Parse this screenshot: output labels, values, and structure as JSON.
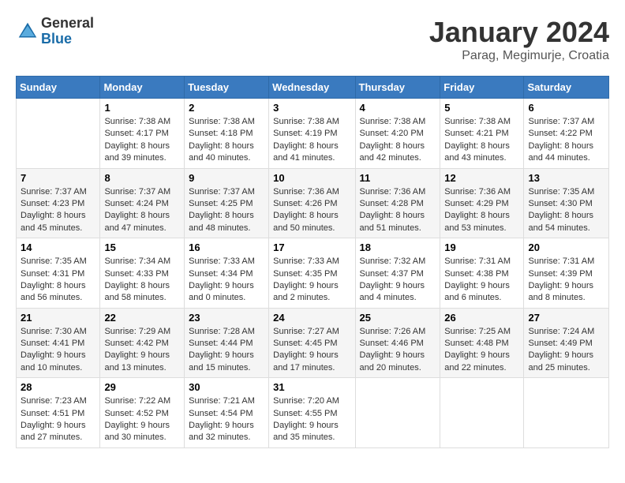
{
  "header": {
    "logo_general": "General",
    "logo_blue": "Blue",
    "month_title": "January 2024",
    "location": "Parag, Megimurje, Croatia"
  },
  "weekdays": [
    "Sunday",
    "Monday",
    "Tuesday",
    "Wednesday",
    "Thursday",
    "Friday",
    "Saturday"
  ],
  "weeks": [
    [
      {
        "day": "",
        "info": ""
      },
      {
        "day": "1",
        "info": "Sunrise: 7:38 AM\nSunset: 4:17 PM\nDaylight: 8 hours\nand 39 minutes."
      },
      {
        "day": "2",
        "info": "Sunrise: 7:38 AM\nSunset: 4:18 PM\nDaylight: 8 hours\nand 40 minutes."
      },
      {
        "day": "3",
        "info": "Sunrise: 7:38 AM\nSunset: 4:19 PM\nDaylight: 8 hours\nand 41 minutes."
      },
      {
        "day": "4",
        "info": "Sunrise: 7:38 AM\nSunset: 4:20 PM\nDaylight: 8 hours\nand 42 minutes."
      },
      {
        "day": "5",
        "info": "Sunrise: 7:38 AM\nSunset: 4:21 PM\nDaylight: 8 hours\nand 43 minutes."
      },
      {
        "day": "6",
        "info": "Sunrise: 7:37 AM\nSunset: 4:22 PM\nDaylight: 8 hours\nand 44 minutes."
      }
    ],
    [
      {
        "day": "7",
        "info": "Sunrise: 7:37 AM\nSunset: 4:23 PM\nDaylight: 8 hours\nand 45 minutes."
      },
      {
        "day": "8",
        "info": "Sunrise: 7:37 AM\nSunset: 4:24 PM\nDaylight: 8 hours\nand 47 minutes."
      },
      {
        "day": "9",
        "info": "Sunrise: 7:37 AM\nSunset: 4:25 PM\nDaylight: 8 hours\nand 48 minutes."
      },
      {
        "day": "10",
        "info": "Sunrise: 7:36 AM\nSunset: 4:26 PM\nDaylight: 8 hours\nand 50 minutes."
      },
      {
        "day": "11",
        "info": "Sunrise: 7:36 AM\nSunset: 4:28 PM\nDaylight: 8 hours\nand 51 minutes."
      },
      {
        "day": "12",
        "info": "Sunrise: 7:36 AM\nSunset: 4:29 PM\nDaylight: 8 hours\nand 53 minutes."
      },
      {
        "day": "13",
        "info": "Sunrise: 7:35 AM\nSunset: 4:30 PM\nDaylight: 8 hours\nand 54 minutes."
      }
    ],
    [
      {
        "day": "14",
        "info": "Sunrise: 7:35 AM\nSunset: 4:31 PM\nDaylight: 8 hours\nand 56 minutes."
      },
      {
        "day": "15",
        "info": "Sunrise: 7:34 AM\nSunset: 4:33 PM\nDaylight: 8 hours\nand 58 minutes."
      },
      {
        "day": "16",
        "info": "Sunrise: 7:33 AM\nSunset: 4:34 PM\nDaylight: 9 hours\nand 0 minutes."
      },
      {
        "day": "17",
        "info": "Sunrise: 7:33 AM\nSunset: 4:35 PM\nDaylight: 9 hours\nand 2 minutes."
      },
      {
        "day": "18",
        "info": "Sunrise: 7:32 AM\nSunset: 4:37 PM\nDaylight: 9 hours\nand 4 minutes."
      },
      {
        "day": "19",
        "info": "Sunrise: 7:31 AM\nSunset: 4:38 PM\nDaylight: 9 hours\nand 6 minutes."
      },
      {
        "day": "20",
        "info": "Sunrise: 7:31 AM\nSunset: 4:39 PM\nDaylight: 9 hours\nand 8 minutes."
      }
    ],
    [
      {
        "day": "21",
        "info": "Sunrise: 7:30 AM\nSunset: 4:41 PM\nDaylight: 9 hours\nand 10 minutes."
      },
      {
        "day": "22",
        "info": "Sunrise: 7:29 AM\nSunset: 4:42 PM\nDaylight: 9 hours\nand 13 minutes."
      },
      {
        "day": "23",
        "info": "Sunrise: 7:28 AM\nSunset: 4:44 PM\nDaylight: 9 hours\nand 15 minutes."
      },
      {
        "day": "24",
        "info": "Sunrise: 7:27 AM\nSunset: 4:45 PM\nDaylight: 9 hours\nand 17 minutes."
      },
      {
        "day": "25",
        "info": "Sunrise: 7:26 AM\nSunset: 4:46 PM\nDaylight: 9 hours\nand 20 minutes."
      },
      {
        "day": "26",
        "info": "Sunrise: 7:25 AM\nSunset: 4:48 PM\nDaylight: 9 hours\nand 22 minutes."
      },
      {
        "day": "27",
        "info": "Sunrise: 7:24 AM\nSunset: 4:49 PM\nDaylight: 9 hours\nand 25 minutes."
      }
    ],
    [
      {
        "day": "28",
        "info": "Sunrise: 7:23 AM\nSunset: 4:51 PM\nDaylight: 9 hours\nand 27 minutes."
      },
      {
        "day": "29",
        "info": "Sunrise: 7:22 AM\nSunset: 4:52 PM\nDaylight: 9 hours\nand 30 minutes."
      },
      {
        "day": "30",
        "info": "Sunrise: 7:21 AM\nSunset: 4:54 PM\nDaylight: 9 hours\nand 32 minutes."
      },
      {
        "day": "31",
        "info": "Sunrise: 7:20 AM\nSunset: 4:55 PM\nDaylight: 9 hours\nand 35 minutes."
      },
      {
        "day": "",
        "info": ""
      },
      {
        "day": "",
        "info": ""
      },
      {
        "day": "",
        "info": ""
      }
    ]
  ]
}
